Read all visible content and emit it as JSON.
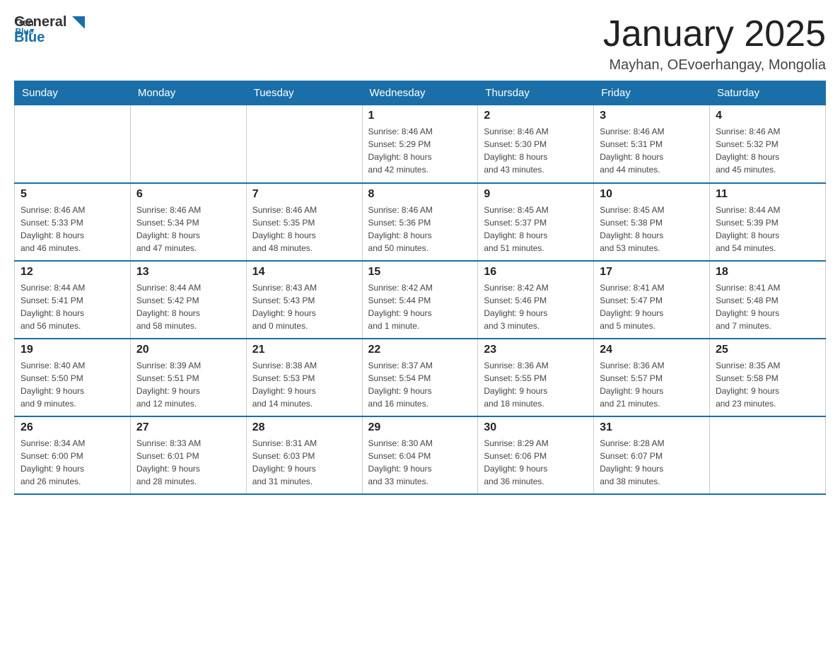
{
  "header": {
    "logo_general": "General",
    "logo_blue": "Blue",
    "title": "January 2025",
    "subtitle": "Mayhan, OEvoerhangay, Mongolia"
  },
  "weekdays": [
    "Sunday",
    "Monday",
    "Tuesday",
    "Wednesday",
    "Thursday",
    "Friday",
    "Saturday"
  ],
  "weeks": [
    [
      {
        "day": "",
        "info": ""
      },
      {
        "day": "",
        "info": ""
      },
      {
        "day": "",
        "info": ""
      },
      {
        "day": "1",
        "info": "Sunrise: 8:46 AM\nSunset: 5:29 PM\nDaylight: 8 hours\nand 42 minutes."
      },
      {
        "day": "2",
        "info": "Sunrise: 8:46 AM\nSunset: 5:30 PM\nDaylight: 8 hours\nand 43 minutes."
      },
      {
        "day": "3",
        "info": "Sunrise: 8:46 AM\nSunset: 5:31 PM\nDaylight: 8 hours\nand 44 minutes."
      },
      {
        "day": "4",
        "info": "Sunrise: 8:46 AM\nSunset: 5:32 PM\nDaylight: 8 hours\nand 45 minutes."
      }
    ],
    [
      {
        "day": "5",
        "info": "Sunrise: 8:46 AM\nSunset: 5:33 PM\nDaylight: 8 hours\nand 46 minutes."
      },
      {
        "day": "6",
        "info": "Sunrise: 8:46 AM\nSunset: 5:34 PM\nDaylight: 8 hours\nand 47 minutes."
      },
      {
        "day": "7",
        "info": "Sunrise: 8:46 AM\nSunset: 5:35 PM\nDaylight: 8 hours\nand 48 minutes."
      },
      {
        "day": "8",
        "info": "Sunrise: 8:46 AM\nSunset: 5:36 PM\nDaylight: 8 hours\nand 50 minutes."
      },
      {
        "day": "9",
        "info": "Sunrise: 8:45 AM\nSunset: 5:37 PM\nDaylight: 8 hours\nand 51 minutes."
      },
      {
        "day": "10",
        "info": "Sunrise: 8:45 AM\nSunset: 5:38 PM\nDaylight: 8 hours\nand 53 minutes."
      },
      {
        "day": "11",
        "info": "Sunrise: 8:44 AM\nSunset: 5:39 PM\nDaylight: 8 hours\nand 54 minutes."
      }
    ],
    [
      {
        "day": "12",
        "info": "Sunrise: 8:44 AM\nSunset: 5:41 PM\nDaylight: 8 hours\nand 56 minutes."
      },
      {
        "day": "13",
        "info": "Sunrise: 8:44 AM\nSunset: 5:42 PM\nDaylight: 8 hours\nand 58 minutes."
      },
      {
        "day": "14",
        "info": "Sunrise: 8:43 AM\nSunset: 5:43 PM\nDaylight: 9 hours\nand 0 minutes."
      },
      {
        "day": "15",
        "info": "Sunrise: 8:42 AM\nSunset: 5:44 PM\nDaylight: 9 hours\nand 1 minute."
      },
      {
        "day": "16",
        "info": "Sunrise: 8:42 AM\nSunset: 5:46 PM\nDaylight: 9 hours\nand 3 minutes."
      },
      {
        "day": "17",
        "info": "Sunrise: 8:41 AM\nSunset: 5:47 PM\nDaylight: 9 hours\nand 5 minutes."
      },
      {
        "day": "18",
        "info": "Sunrise: 8:41 AM\nSunset: 5:48 PM\nDaylight: 9 hours\nand 7 minutes."
      }
    ],
    [
      {
        "day": "19",
        "info": "Sunrise: 8:40 AM\nSunset: 5:50 PM\nDaylight: 9 hours\nand 9 minutes."
      },
      {
        "day": "20",
        "info": "Sunrise: 8:39 AM\nSunset: 5:51 PM\nDaylight: 9 hours\nand 12 minutes."
      },
      {
        "day": "21",
        "info": "Sunrise: 8:38 AM\nSunset: 5:53 PM\nDaylight: 9 hours\nand 14 minutes."
      },
      {
        "day": "22",
        "info": "Sunrise: 8:37 AM\nSunset: 5:54 PM\nDaylight: 9 hours\nand 16 minutes."
      },
      {
        "day": "23",
        "info": "Sunrise: 8:36 AM\nSunset: 5:55 PM\nDaylight: 9 hours\nand 18 minutes."
      },
      {
        "day": "24",
        "info": "Sunrise: 8:36 AM\nSunset: 5:57 PM\nDaylight: 9 hours\nand 21 minutes."
      },
      {
        "day": "25",
        "info": "Sunrise: 8:35 AM\nSunset: 5:58 PM\nDaylight: 9 hours\nand 23 minutes."
      }
    ],
    [
      {
        "day": "26",
        "info": "Sunrise: 8:34 AM\nSunset: 6:00 PM\nDaylight: 9 hours\nand 26 minutes."
      },
      {
        "day": "27",
        "info": "Sunrise: 8:33 AM\nSunset: 6:01 PM\nDaylight: 9 hours\nand 28 minutes."
      },
      {
        "day": "28",
        "info": "Sunrise: 8:31 AM\nSunset: 6:03 PM\nDaylight: 9 hours\nand 31 minutes."
      },
      {
        "day": "29",
        "info": "Sunrise: 8:30 AM\nSunset: 6:04 PM\nDaylight: 9 hours\nand 33 minutes."
      },
      {
        "day": "30",
        "info": "Sunrise: 8:29 AM\nSunset: 6:06 PM\nDaylight: 9 hours\nand 36 minutes."
      },
      {
        "day": "31",
        "info": "Sunrise: 8:28 AM\nSunset: 6:07 PM\nDaylight: 9 hours\nand 38 minutes."
      },
      {
        "day": "",
        "info": ""
      }
    ]
  ]
}
